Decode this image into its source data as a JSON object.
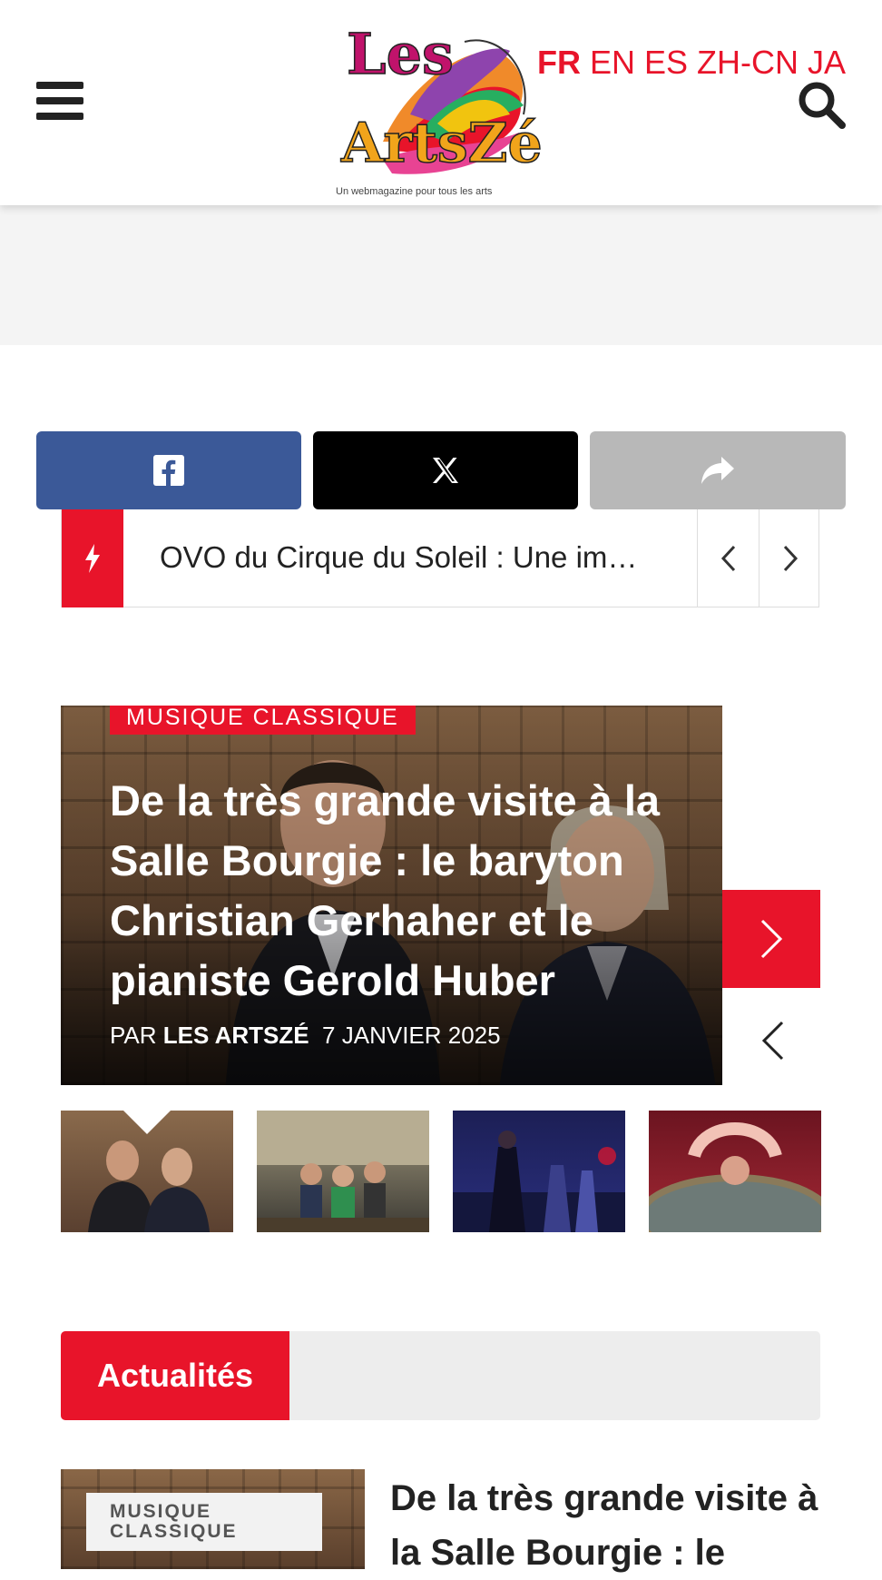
{
  "header": {
    "languages": [
      {
        "label": "FR",
        "active": true
      },
      {
        "label": "EN",
        "active": false
      },
      {
        "label": "ES",
        "active": false
      },
      {
        "label": "ZH-CN",
        "active": false
      },
      {
        "label": "JA",
        "active": false
      }
    ],
    "logo": {
      "line1": "Les",
      "line2": "ArtsZé",
      "tagline": "Un webmagazine pour tous les arts"
    },
    "icons": {
      "menu": "hamburger-menu-icon",
      "search": "search-icon"
    }
  },
  "share": {
    "icons": [
      "facebook-icon",
      "x-icon",
      "share-arrow-icon"
    ],
    "colors": {
      "facebook": "#3b5998",
      "x": "#000000",
      "share": "#b8b8b8"
    }
  },
  "ticker": {
    "headline": "OVO du Cirque du Soleil : Une im…",
    "icons": {
      "bolt": "lightning-icon",
      "prev": "chevron-left-icon",
      "next": "chevron-right-icon"
    }
  },
  "featured": {
    "category": "MUSIQUE CLASSIQUE",
    "title": "De la très grande visite à la Salle Bourgie : le baryton Christian Gerhaher et le pianiste Gerold Huber",
    "byline_prefix": "PAR",
    "author": "LES ARTSZÉ",
    "date": "7 JANVIER 2025",
    "icons": {
      "next": "chevron-right-icon",
      "prev": "chevron-left-icon"
    }
  },
  "section": {
    "label": "Actualités"
  },
  "article": {
    "category": "MUSIQUE CLASSIQUE",
    "title": "De la très grande visite à la Salle Bourgie : le"
  },
  "colors": {
    "accent": "#e8142a",
    "text": "#222222",
    "band": "#f4f4f4"
  }
}
